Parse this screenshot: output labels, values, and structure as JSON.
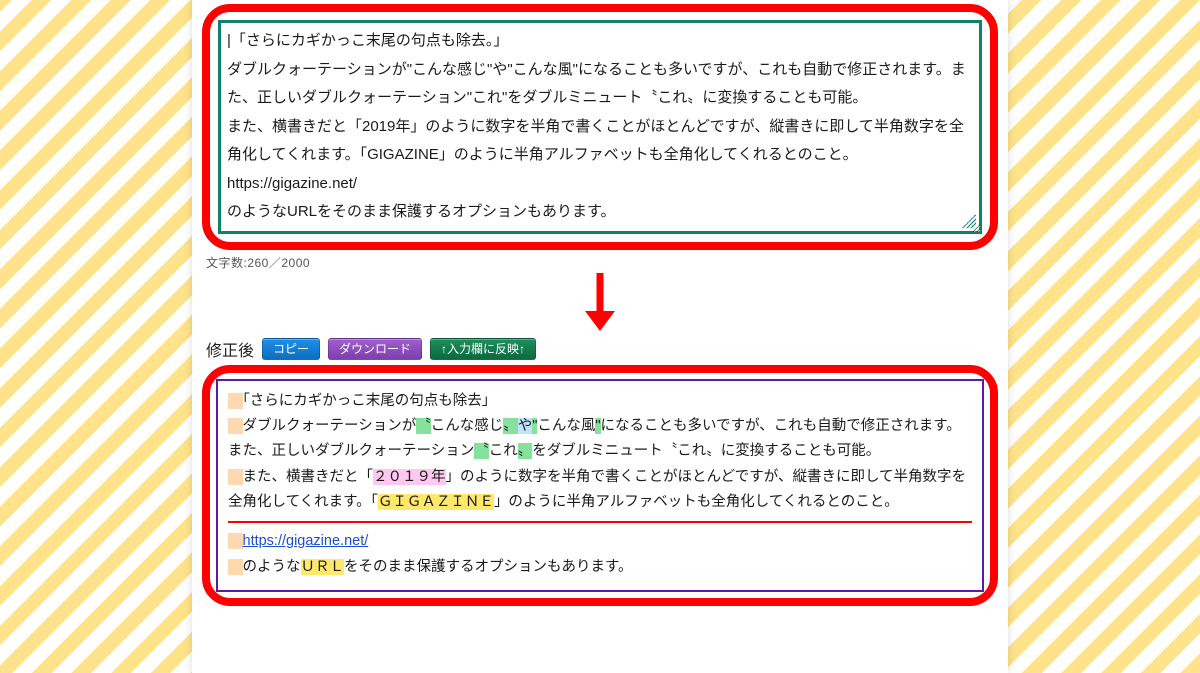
{
  "input": {
    "line1": "|「さらにカギかっこ末尾の句点も除去。」",
    "line2": "ダブルクォーテーションが\"こんな感じ\"や\"こんな風\"になることも多いですが、これも自動で修正されます。また、正しいダブルクォーテーション\"これ\"をダブルミニュート〝これ〟に変換することも可能。",
    "line3": "また、横書きだと「2019年」のように数字を半角で書くことがほとんどですが、縦書きに即して半角数字を全角化してくれます。「GIGAZINE」のように半角アルファベットも全角化してくれるとのこと。",
    "blank": "",
    "line4": "https://gigazine.net/",
    "line5": "のようなURLをそのまま保護するオプションもあります。"
  },
  "charcount": "文字数:260／2000",
  "after_label": "修正後",
  "buttons": {
    "copy": "コピー",
    "download": "ダウンロード",
    "reflect": "↑入力欄に反映↑"
  },
  "output": {
    "l1": "「さらにカギかっこ末尾の句点も除去」",
    "l2_a": "ダブルクォーテーションが",
    "l2_q1a": "〝",
    "l2_q1b": "こんな感じ",
    "l2_q1c": "〟",
    "l2_mid": "や",
    "l2_q2a": "\"",
    "l2_q2b": "こんな風",
    "l2_q2c": "\"",
    "l2_b": "になることも多いですが、これも自動で修正されます。また、正しいダブルクォーテーション",
    "l2_q3a": "〝",
    "l2_q3b": "これ",
    "l2_q3c": "〟",
    "l2_c": "をダブルミニュート〝これ〟に変換することも可能。",
    "l3_a": "また、横書きだと「",
    "l3_year": "２０１９年",
    "l3_b": "」のように数字を半角で書くことがほとんどですが、縦書きに即して半角数字を全角化してくれます。「",
    "l3_giga": "ＧＩＧＡＺＩＮＥ",
    "l3_c": "」のように半角アルファベットも全角化してくれるとのこと。",
    "url": "https://gigazine.net/",
    "l5_a": "のような",
    "l5_url": "ＵＲＬ",
    "l5_b": "をそのまま保護するオプションもあります。"
  }
}
